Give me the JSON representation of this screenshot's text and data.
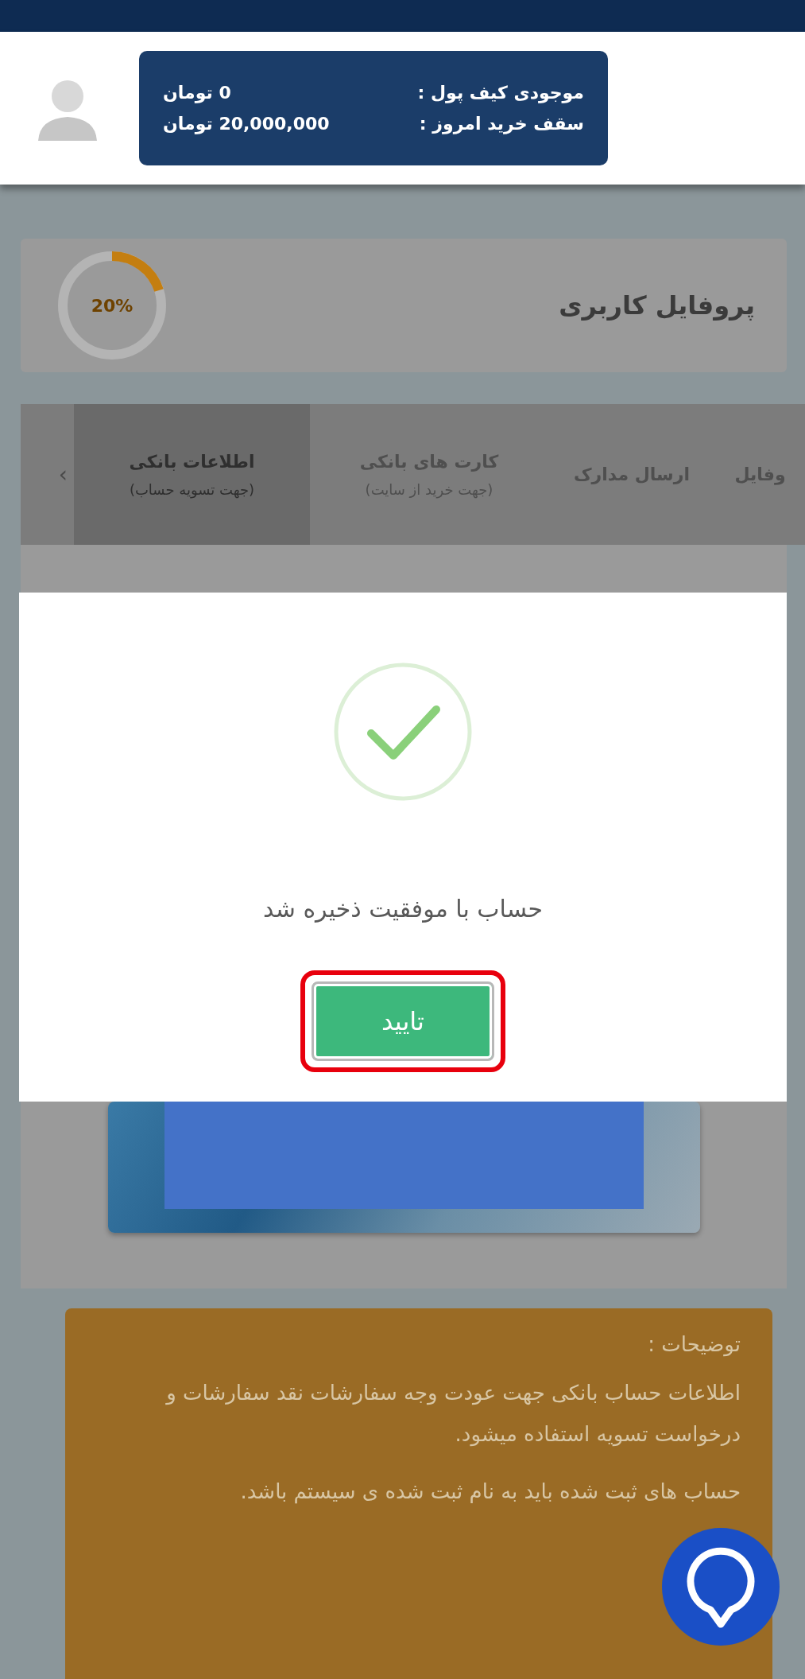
{
  "wallet": {
    "rows": [
      {
        "label": "موجودی کیف پول :",
        "value": "0 تومان"
      },
      {
        "label": "سقف خرید امروز :",
        "value": "20,000,000 تومان"
      }
    ]
  },
  "profile": {
    "title": "پروفایل کاربری",
    "completion": "20%",
    "level": 0.2
  },
  "tabs": [
    {
      "lines": [
        "وفایل"
      ],
      "selected": false
    },
    {
      "lines": [
        "ارسال مدارک"
      ],
      "selected": false
    },
    {
      "lines": [
        "کارت های بانکی",
        "(جهت خرید از سایت)"
      ],
      "selected": false
    },
    {
      "lines": [
        "اطلاعات بانکی",
        "(جهت تسویه حساب)"
      ],
      "selected": true
    }
  ],
  "tabs_scroll_arrow": "‹",
  "dialog": {
    "message": "حساب با موفقیت ذخیره شد",
    "confirm_button": "تایید",
    "confirm_highlighted": true
  },
  "notes": {
    "title": "توضیحات :",
    "paragraphs": [
      "اطلاعات حساب بانکی جهت عودت وجه سفارشات نقد سفارشات و درخواست تسویه استفاده میشود.",
      "حساب های ثبت شده باید به نام ثبت شده ی سیستم باشد."
    ]
  }
}
